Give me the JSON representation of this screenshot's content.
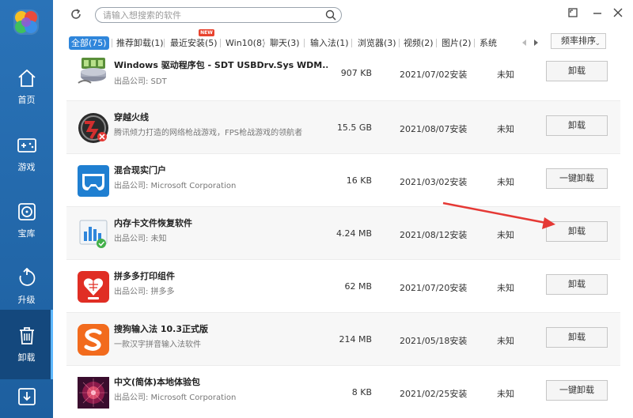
{
  "sidebar": {
    "items": [
      {
        "label": "首页",
        "icon": "home-icon"
      },
      {
        "label": "游戏",
        "icon": "gamepad-icon"
      },
      {
        "label": "宝库",
        "icon": "disc-icon"
      },
      {
        "label": "升级",
        "icon": "upgrade-icon"
      },
      {
        "label": "卸载",
        "icon": "trash-icon"
      },
      {
        "label": "",
        "icon": "download-icon"
      }
    ],
    "active_index": 4,
    "colors": {
      "bg": "#2a73b8",
      "active_bg": "#14487d"
    }
  },
  "search": {
    "placeholder": "请输入想搜索的软件",
    "value": ""
  },
  "tabs": [
    {
      "label": "全部(75)",
      "active": true
    },
    {
      "label": "推荐卸载(1)"
    },
    {
      "label": "最近安装(5)",
      "badge": "NEW"
    },
    {
      "label": "Win10(8)"
    },
    {
      "label": "聊天(3)"
    },
    {
      "label": "输入法(1)"
    },
    {
      "label": "浏览器(3)"
    },
    {
      "label": "视频(2)"
    },
    {
      "label": "图片(2)"
    },
    {
      "label": "系统"
    }
  ],
  "sort": {
    "label": "频率排序",
    "caret": "⌄"
  },
  "rows": [
    {
      "name": "Windows 驱动程序包 - SDT USBDrv.Sys WDM...",
      "desc": "出品公司: SDT",
      "size": "907 KB",
      "date": "2021/07/02安装",
      "status": "未知",
      "action": "卸载",
      "icon": "driver-package-icon"
    },
    {
      "name": "穿越火线",
      "desc": "腾讯倾力打造的网络枪战游戏，FPS枪战游戏的领航者",
      "size": "15.5 GB",
      "date": "2021/08/07安装",
      "status": "未知",
      "action": "卸载",
      "icon": "crossfire-icon"
    },
    {
      "name": "混合现实门户",
      "desc": "出品公司: Microsoft Corporation",
      "size": "16 KB",
      "date": "2021/03/02安装",
      "status": "未知",
      "action": "一键卸载",
      "icon": "mixed-reality-icon"
    },
    {
      "name": "内存卡文件恢复软件",
      "desc": "出品公司: 未知",
      "size": "4.24 MB",
      "date": "2021/08/12安装",
      "status": "未知",
      "action": "卸载",
      "icon": "recovery-icon"
    },
    {
      "name": "拼多多打印组件",
      "desc": "出品公司: 拼多多",
      "size": "62 MB",
      "date": "2021/07/20安装",
      "status": "未知",
      "action": "卸载",
      "icon": "pinduoduo-icon"
    },
    {
      "name": "搜狗输入法 10.3正式版",
      "desc": "一款汉字拼音输入法软件",
      "size": "214 MB",
      "date": "2021/05/18安装",
      "status": "未知",
      "action": "卸载",
      "icon": "sogou-icon"
    },
    {
      "name": "中文(简体)本地体验包",
      "desc": "出品公司: Microsoft Corporation",
      "size": "8 KB",
      "date": "2021/02/25安装",
      "status": "未知",
      "action": "一键卸载",
      "icon": "language-pack-icon"
    }
  ],
  "annotation": {
    "color": "#e53935",
    "points_to": "row-3-uninstall"
  }
}
